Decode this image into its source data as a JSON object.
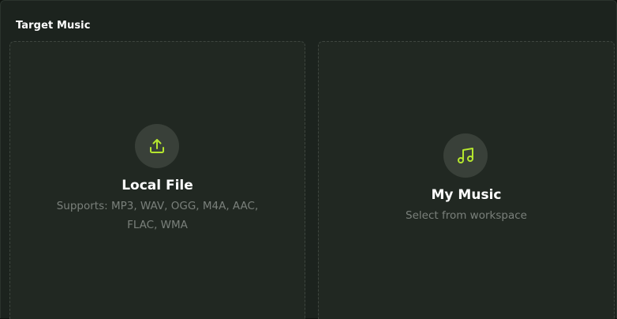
{
  "section": {
    "title": "Target Music"
  },
  "local_file": {
    "icon": "upload-icon",
    "title": "Local File",
    "subtitle_line1": "Supports: MP3, WAV, OGG, M4A, AAC,",
    "subtitle_line2": "FLAC, WMA"
  },
  "my_music": {
    "icon": "music-note-icon",
    "title": "My Music",
    "subtitle": "Select from workspace"
  },
  "colors": {
    "accent": "#b5e62e",
    "card_background": "#212822",
    "panel_background": "#1c231e",
    "subtitle_text": "#7a807b"
  }
}
